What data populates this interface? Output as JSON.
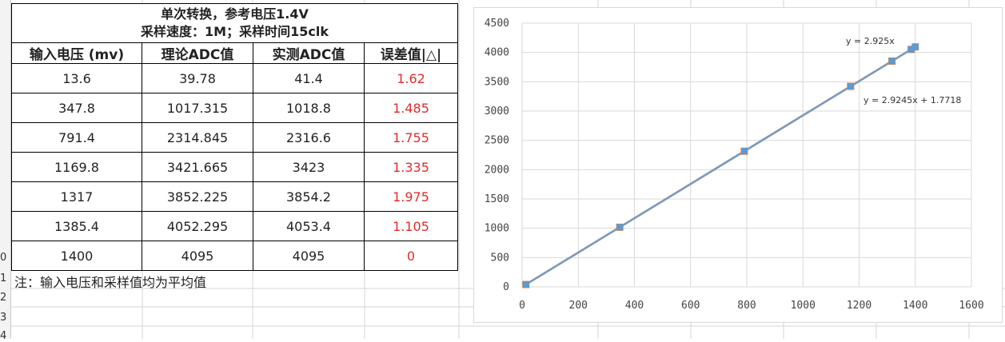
{
  "table": {
    "title_line1": "单次转换，参考电压1.4V",
    "title_line2": "采样速度：1M；采样时间15clk",
    "headers": [
      "输入电压 (mv)",
      "理论ADC值",
      "实测ADC值",
      "误差值|△|"
    ],
    "rows": [
      [
        "13.6",
        "39.78",
        "41.4",
        "1.62"
      ],
      [
        "347.8",
        "1017.315",
        "1018.8",
        "1.485"
      ],
      [
        "791.4",
        "2314.845",
        "2316.6",
        "1.755"
      ],
      [
        "1169.8",
        "3421.665",
        "3423",
        "1.335"
      ],
      [
        "1317",
        "3852.225",
        "3854.2",
        "1.975"
      ],
      [
        "1385.4",
        "4052.295",
        "4053.4",
        "1.105"
      ],
      [
        "1400",
        "4095",
        "4095",
        "0"
      ]
    ],
    "note": "注：输入电压和采样值均为平均值"
  },
  "row_numbers": [
    "0",
    "1",
    "2",
    "3",
    "4"
  ],
  "colors": {
    "error_text": "#e02b2b",
    "series_orange": "#ed7d31",
    "series_blue": "#5b9bd5",
    "trend_line": "#7f98b8"
  },
  "chart_data": {
    "type": "scatter",
    "xlim": [
      0,
      1600
    ],
    "ylim": [
      0,
      4500
    ],
    "x_ticks": [
      0,
      200,
      400,
      600,
      800,
      1000,
      1200,
      1400,
      1600
    ],
    "y_ticks": [
      0,
      500,
      1000,
      1500,
      2000,
      2500,
      3000,
      3500,
      4000,
      4500
    ],
    "grid": true,
    "series": [
      {
        "color": "#ed7d31",
        "x": [
          13.6,
          347.8,
          791.4,
          1169.8,
          1317,
          1385.4,
          1400
        ],
        "y": [
          39.78,
          1017.315,
          2314.845,
          3421.665,
          3852.225,
          4052.295,
          4095
        ]
      },
      {
        "color": "#5b9bd5",
        "x": [
          13.6,
          347.8,
          791.4,
          1169.8,
          1317,
          1385.4,
          1400
        ],
        "y": [
          41.4,
          1018.8,
          2316.6,
          3423,
          3854.2,
          4053.4,
          4095
        ]
      }
    ],
    "trendlines": [
      {
        "label": "y = 2.925x",
        "slope": 2.925,
        "intercept": 0
      },
      {
        "label": "y = 2.9245x + 1.7718",
        "slope": 2.9245,
        "intercept": 1.7718
      }
    ]
  }
}
